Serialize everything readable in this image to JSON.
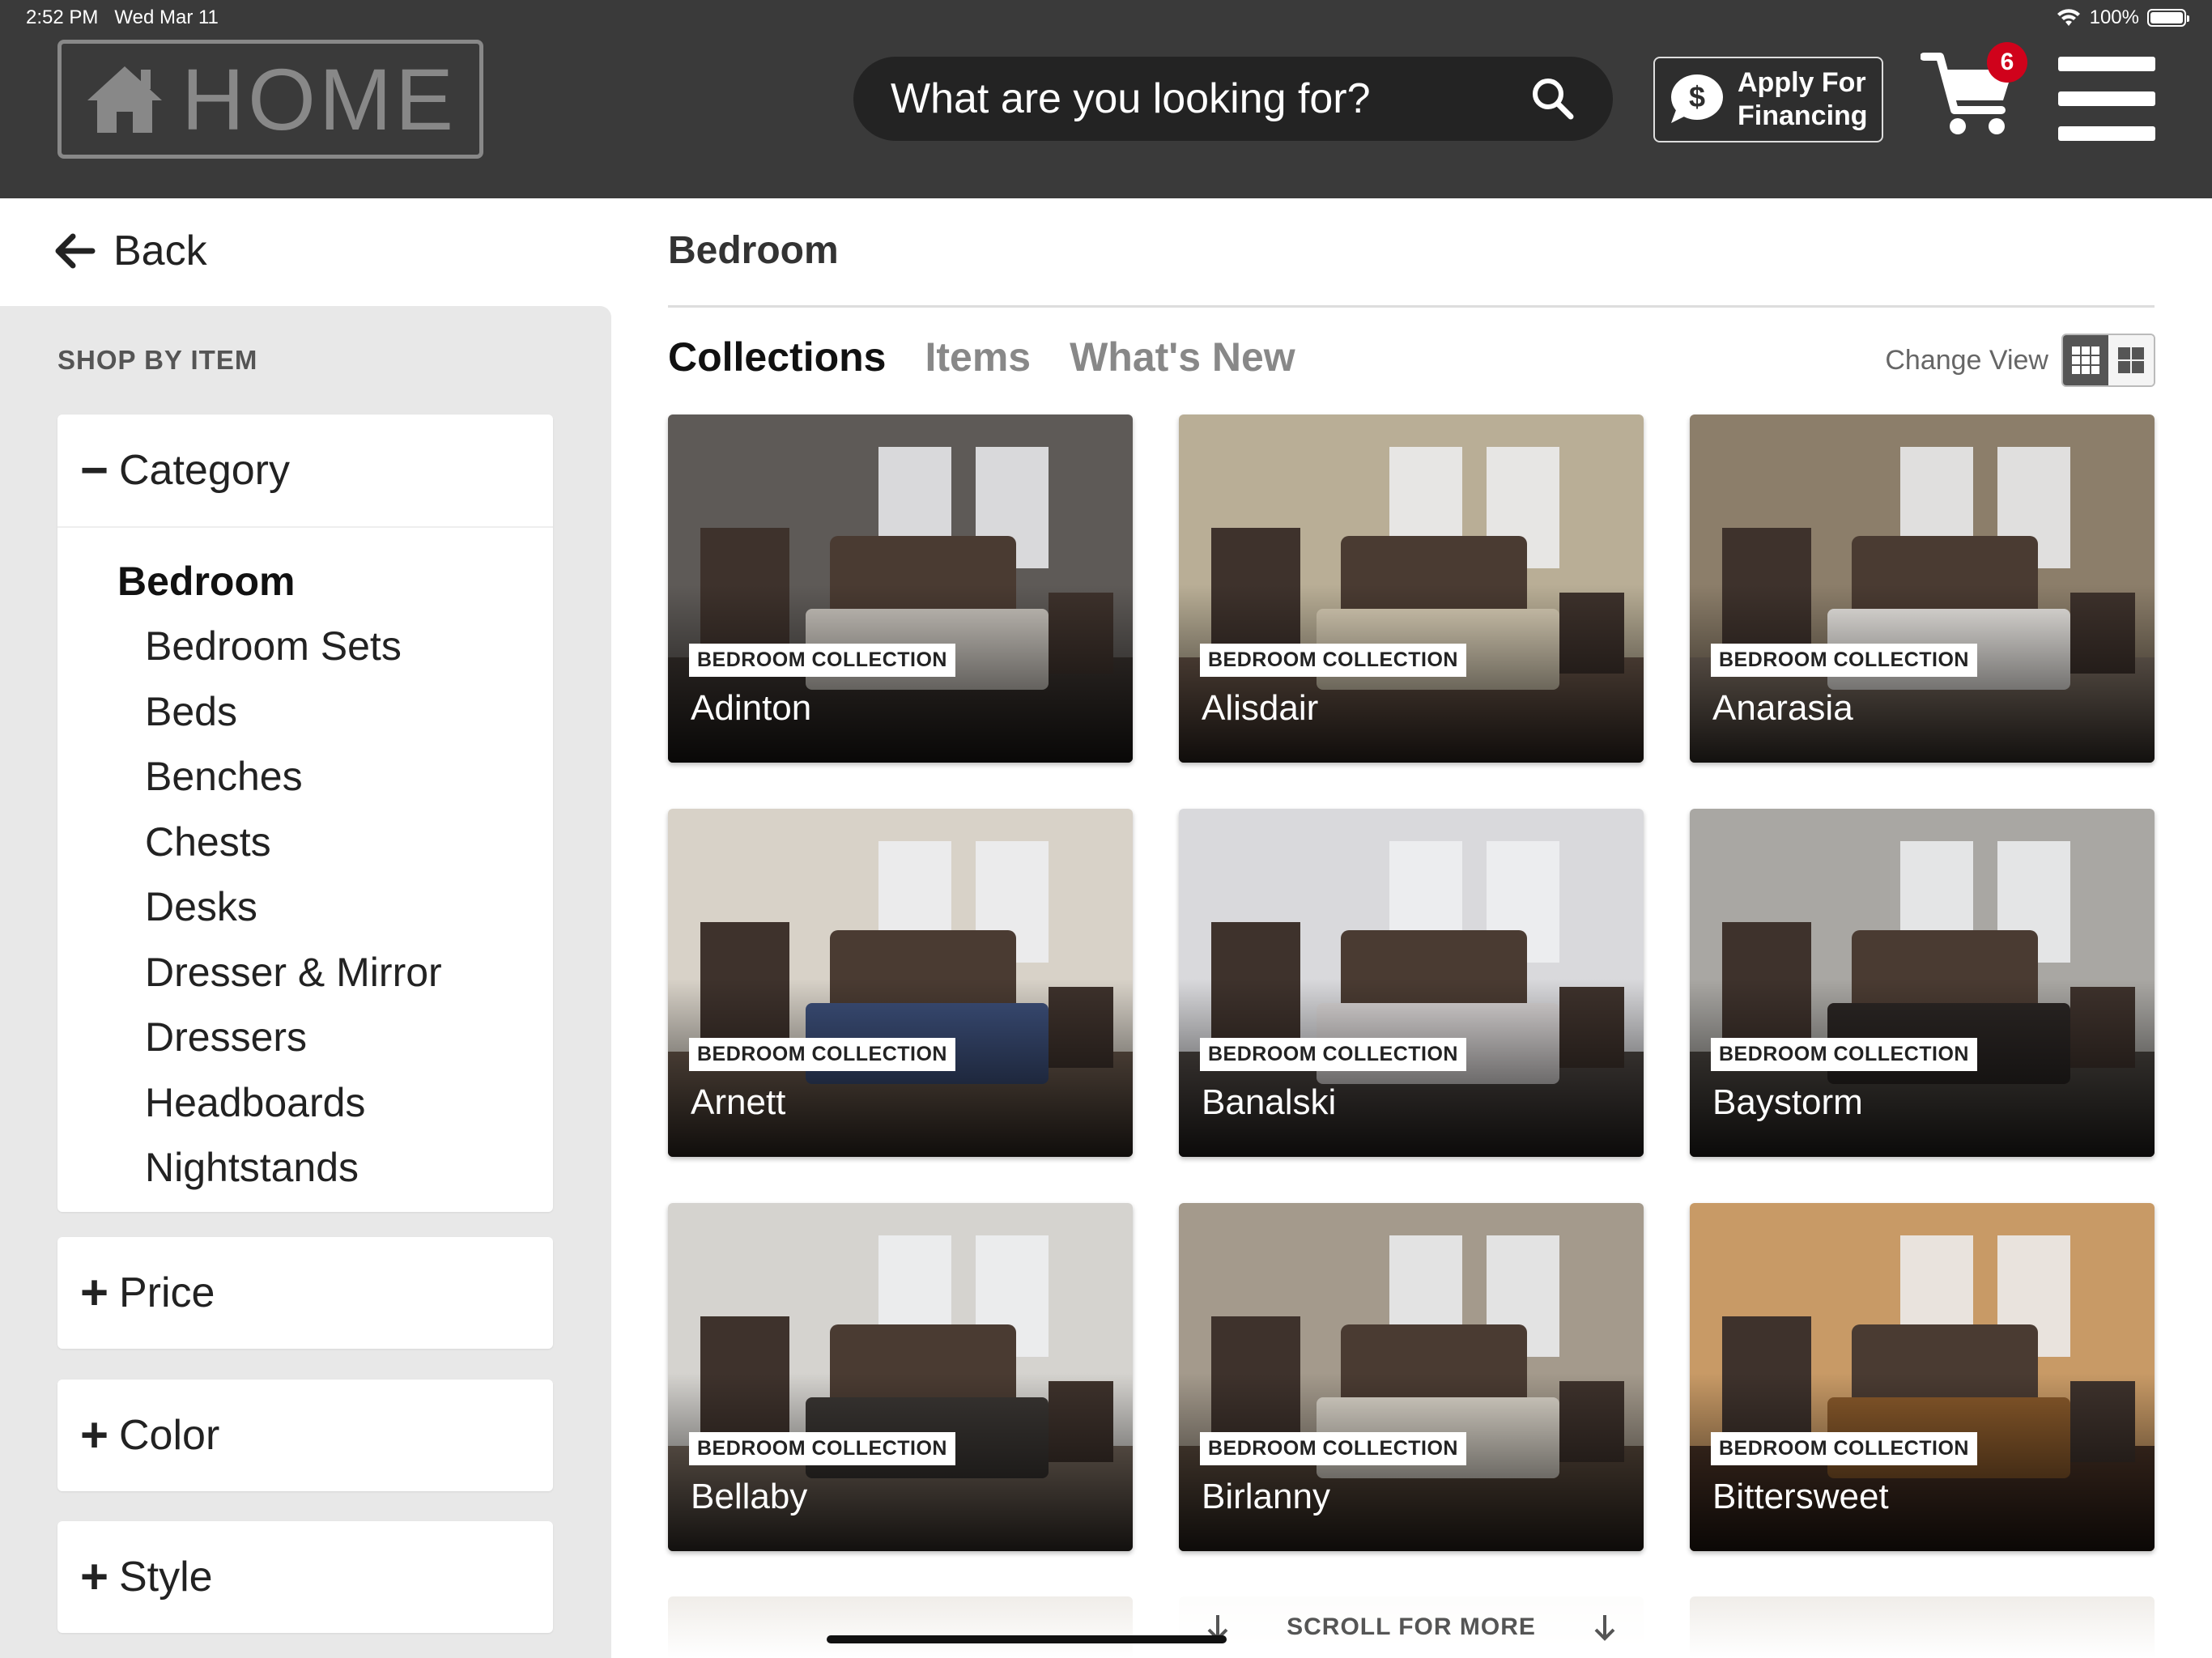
{
  "status_bar": {
    "time": "2:52 PM",
    "date": "Wed Mar 11",
    "battery": "100%"
  },
  "header": {
    "logo_text": "HOME",
    "search_placeholder": "What are you looking for?",
    "financing_label_line1": "Apply For",
    "financing_label_line2": "Financing",
    "cart_count": "6"
  },
  "sidebar": {
    "back_label": "Back",
    "shop_by_label": "SHOP BY ITEM",
    "category": {
      "label": "Category",
      "sign": "−",
      "current": "Bedroom",
      "items": [
        "Bedroom Sets",
        "Beds",
        "Benches",
        "Chests",
        "Desks",
        "Dresser & Mirror",
        "Dressers",
        "Headboards",
        "Nightstands"
      ]
    },
    "filters": [
      {
        "label": "Price",
        "sign": "+"
      },
      {
        "label": "Color",
        "sign": "+"
      },
      {
        "label": "Style",
        "sign": "+"
      }
    ]
  },
  "main": {
    "title": "Bedroom",
    "tabs": [
      {
        "label": "Collections",
        "active": true
      },
      {
        "label": "Items",
        "active": false
      },
      {
        "label": "What's New",
        "active": false
      }
    ],
    "change_view_label": "Change View",
    "collection_tag": "BEDROOM COLLECTION",
    "collections": [
      {
        "name": "Adinton",
        "wall": "#5e5a57",
        "floor": "#3b3430",
        "bed": "#c9c4bd"
      },
      {
        "name": "Alisdair",
        "wall": "#b9ae96",
        "floor": "#6a5649",
        "bed": "#d8cdb5"
      },
      {
        "name": "Anarasia",
        "wall": "#8c7e6a",
        "floor": "#7d6f63",
        "bed": "#e9e6e2"
      },
      {
        "name": "Arnett",
        "wall": "#d8d2c8",
        "floor": "#6b5a4d",
        "bed": "#3c4f7a"
      },
      {
        "name": "Banalski",
        "wall": "#d9d9dc",
        "floor": "#504945",
        "bed": "#dad6d6"
      },
      {
        "name": "Baystorm",
        "wall": "#a9a7a3",
        "floor": "#4b4641",
        "bed": "#2b2624"
      },
      {
        "name": "Bellaby",
        "wall": "#d5d3cf",
        "floor": "#7a6c60",
        "bed": "#3a3633"
      },
      {
        "name": "Birlanny",
        "wall": "#a49a8c",
        "floor": "#5a4a3d",
        "bed": "#dcd6cb"
      },
      {
        "name": "Bittersweet",
        "wall": "#c89a66",
        "floor": "#4a3326",
        "bed": "#8a5a2b"
      }
    ],
    "scroll_hint": "SCROLL FOR MORE"
  }
}
